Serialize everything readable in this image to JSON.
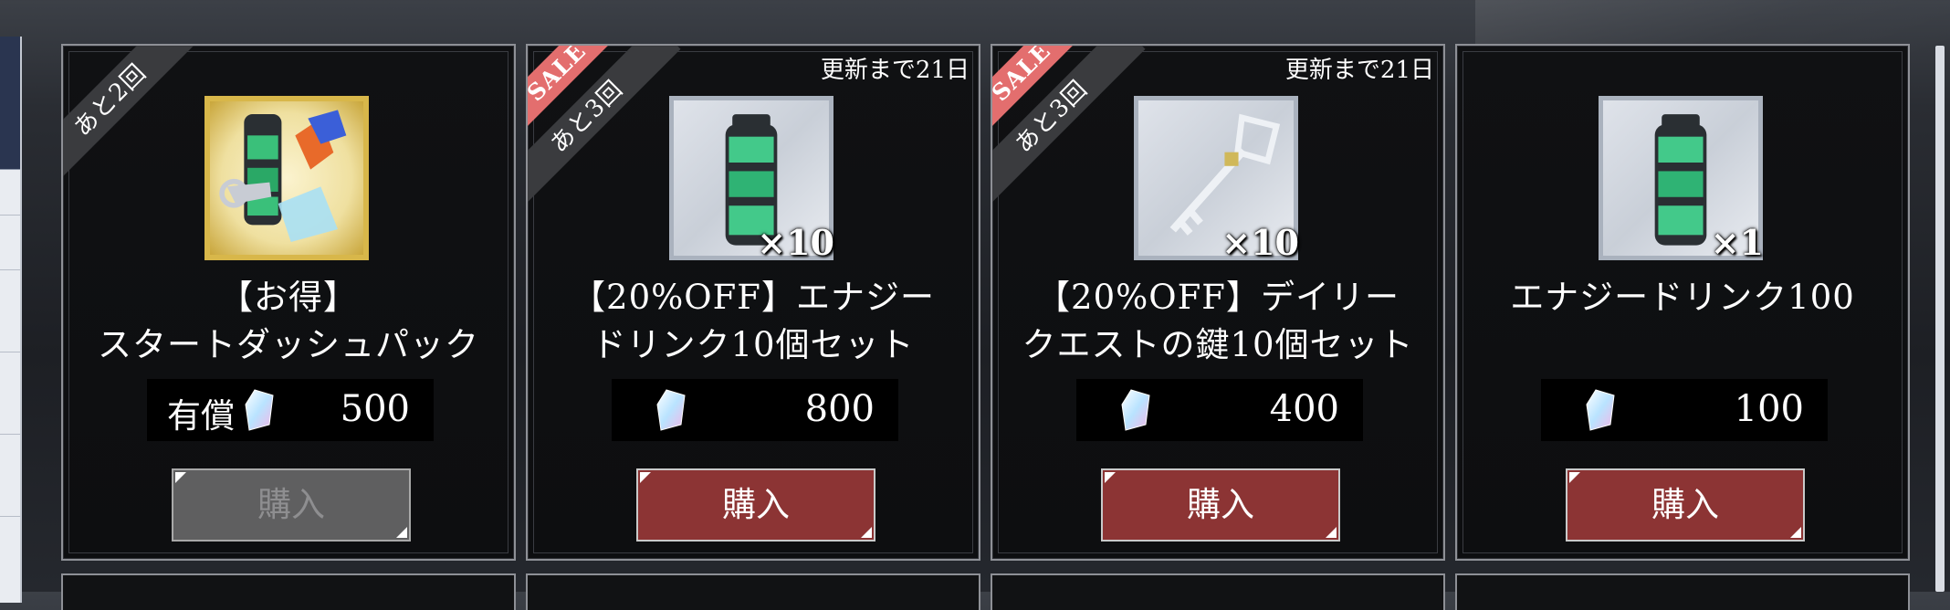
{
  "cards": [
    {
      "ribbon_count": "あと2回",
      "sale": "",
      "refresh": "",
      "qty": "",
      "title_line1": "【お得】",
      "title_line2": "スタートダッシュパック",
      "paid_label": "有償",
      "price": "500",
      "buy_label": "購入",
      "icon": "start-dash-pack-icon",
      "buy_enabled": false
    },
    {
      "ribbon_count": "あと3回",
      "sale": "SALE",
      "refresh": "更新まで21日",
      "qty": "×10",
      "title_line1": "【20%OFF】エナジー",
      "title_line2": "ドリンク10個セット",
      "paid_label": "",
      "price": "800",
      "buy_label": "購入",
      "icon": "energy-drink-icon",
      "buy_enabled": true
    },
    {
      "ribbon_count": "あと3回",
      "sale": "SALE",
      "refresh": "更新まで21日",
      "qty": "×10",
      "title_line1": "【20%OFF】デイリー",
      "title_line2": "クエストの鍵10個セット",
      "paid_label": "",
      "price": "400",
      "buy_label": "購入",
      "icon": "quest-key-icon",
      "buy_enabled": true
    },
    {
      "ribbon_count": "",
      "sale": "",
      "refresh": "",
      "qty": "×1",
      "title_line1": "エナジードリンク100",
      "title_line2": "",
      "paid_label": "",
      "price": "100",
      "buy_label": "購入",
      "icon": "energy-drink-icon",
      "buy_enabled": true
    }
  ],
  "colors": {
    "buy_button": "#8c3434",
    "buy_button_disabled": "#5f5f60",
    "sale_ribbon": "#e36e6e",
    "count_ribbon": "#3a3b3e",
    "gold_frame": "#d8b74a"
  }
}
